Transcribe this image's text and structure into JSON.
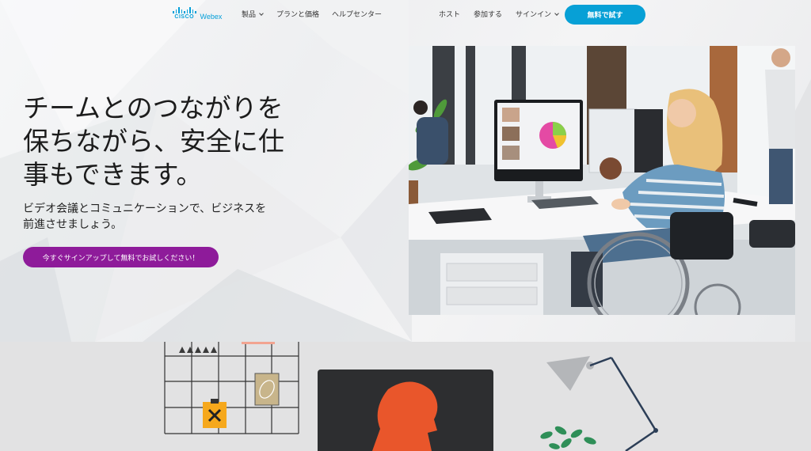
{
  "brand": {
    "company": "CISCO",
    "product": "Webex",
    "accent": "#049fd9"
  },
  "nav": {
    "left_items": [
      {
        "label": "製品",
        "has_dropdown": true
      },
      {
        "label": "プランと価格",
        "has_dropdown": false
      },
      {
        "label": "ヘルプセンター",
        "has_dropdown": false
      }
    ],
    "right_items": [
      {
        "label": "ホスト",
        "has_dropdown": false
      },
      {
        "label": "参加する",
        "has_dropdown": false
      },
      {
        "label": "サインイン",
        "has_dropdown": true
      }
    ],
    "trial_button": {
      "label": "無料で試す",
      "color": "#07a0d6"
    }
  },
  "hero": {
    "headline_lines": [
      "チームとのつながりを",
      "保ちながら、安全に仕",
      "事もできます。"
    ],
    "subcopy_lines": [
      "ビデオ会議とコミュニケーションで、ビジネスを",
      "前進させましょう。"
    ],
    "cta": {
      "label": "今すぐサインアップして無料でお試しください！",
      "color": "#8e1b9a"
    }
  },
  "illustration_colors": {
    "head": "#e9562b",
    "screen": "#2d2e30",
    "clipboard": "#f6a81c",
    "plant": "#2f8f58"
  }
}
